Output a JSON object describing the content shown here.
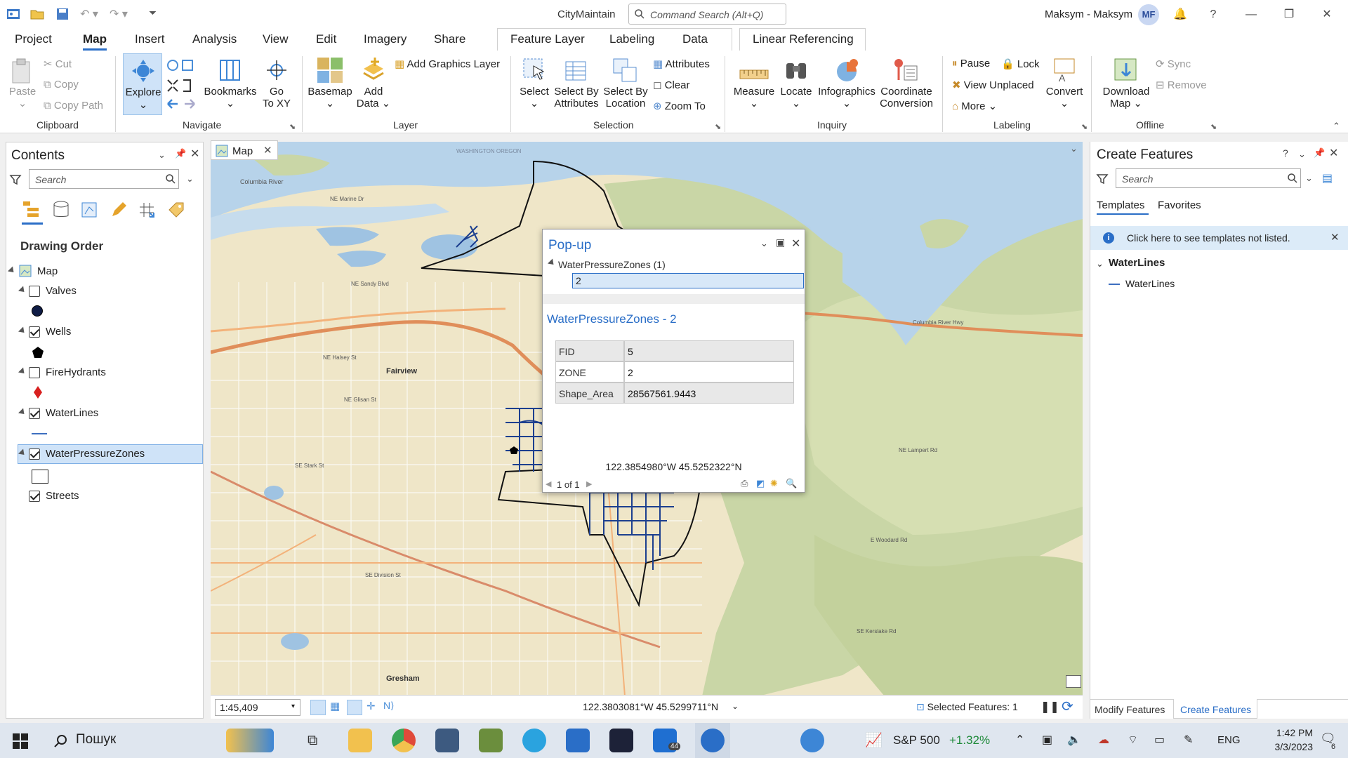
{
  "app": {
    "title": "CityMaintain",
    "command_search_placeholder": "Command Search (Alt+Q)",
    "user": "Maksym - Maksym",
    "user_initials": "MF"
  },
  "tabs": [
    "Project",
    "Map",
    "Insert",
    "Analysis",
    "View",
    "Edit",
    "Imagery",
    "Share"
  ],
  "active_tab": "Map",
  "context_tabs": {
    "feature_layer": "Feature Layer",
    "labeling": "Labeling",
    "data": "Data",
    "linear_referencing": "Linear Referencing"
  },
  "ribbon": {
    "clipboard": {
      "paste": "Paste",
      "cut": "Cut",
      "copy": "Copy",
      "copy_path": "Copy Path",
      "group": "Clipboard"
    },
    "navigate": {
      "explore": "Explore",
      "bookmarks": "Bookmarks",
      "go_to_xy_1": "Go",
      "go_to_xy_2": "To XY",
      "group": "Navigate"
    },
    "layer": {
      "basemap": "Basemap",
      "add_data_1": "Add",
      "add_data_2": "Data",
      "add_graphics_layer": "Add Graphics Layer",
      "group": "Layer"
    },
    "selection": {
      "select": "Select",
      "select_by_attributes_1": "Select By",
      "select_by_attributes_2": "Attributes",
      "select_by_location_1": "Select By",
      "select_by_location_2": "Location",
      "attributes": "Attributes",
      "clear": "Clear",
      "zoom_to": "Zoom To",
      "group": "Selection"
    },
    "inquiry": {
      "measure": "Measure",
      "locate": "Locate",
      "infographics": "Infographics",
      "coordinate_conversion_1": "Coordinate",
      "coordinate_conversion_2": "Conversion",
      "group": "Inquiry"
    },
    "labeling": {
      "pause": "Pause",
      "lock": "Lock",
      "view_unplaced": "View Unplaced",
      "more": "More",
      "convert": "Convert",
      "group": "Labeling"
    },
    "offline": {
      "download_map_1": "Download",
      "download_map_2": "Map",
      "sync": "Sync",
      "remove": "Remove",
      "group": "Offline"
    }
  },
  "contents": {
    "title": "Contents",
    "search_placeholder": "Search",
    "drawing_order": "Drawing Order",
    "map_label": "Map",
    "layers": [
      {
        "name": "Valves",
        "checked": false
      },
      {
        "name": "Wells",
        "checked": true
      },
      {
        "name": "FireHydrants",
        "checked": false
      },
      {
        "name": "WaterLines",
        "checked": true
      },
      {
        "name": "WaterPressureZones",
        "checked": true
      },
      {
        "name": "Streets",
        "checked": true
      }
    ]
  },
  "map_tab": "Map",
  "popup": {
    "title": "Pop-up",
    "layer_node": "WaterPressureZones (1)",
    "feature_node": "2",
    "feature_title": "WaterPressureZones - 2",
    "attributes": [
      {
        "key": "FID",
        "value": "5"
      },
      {
        "key": "ZONE",
        "value": "2"
      },
      {
        "key": "Shape_Area",
        "value": "28567561.9443"
      }
    ],
    "coordinates": "122.3854980°W 45.5252322°N",
    "pager": "1 of 1"
  },
  "status": {
    "scale": "1:45,409",
    "coordinates": "122.3803081°W 45.5299711°N",
    "selected_features": "Selected Features: 1"
  },
  "create_features": {
    "title": "Create Features",
    "search_placeholder": "Search",
    "tab_templates": "Templates",
    "tab_favorites": "Favorites",
    "info": "Click here to see templates not listed.",
    "group": "WaterLines",
    "template": "WaterLines",
    "bottom_tab_modify": "Modify Features",
    "bottom_tab_create": "Create Features"
  },
  "map_labels": {
    "fairview": "Fairview",
    "gresham": "Gresham",
    "columbia_river": "Columbia River",
    "washington_oregon": "WASHINGTON OREGON",
    "sandy_blvd": "NE Sandy Blvd",
    "marine_dr": "NE Marine Dr",
    "halsey": "NE Halsey St",
    "glisan": "NE Glisan St",
    "stark": "SE Stark St",
    "division": "SE Division St",
    "columbia_river_hwy": "Columbia River Hwy",
    "woodard": "E Woodard Rd",
    "kerslake": "SE Kerslake Rd",
    "lampert": "NE Lampert Rd"
  },
  "taskbar": {
    "search": "Пошук",
    "ticker": "S&P 500",
    "ticker_change": "+1.32%",
    "lang": "ENG",
    "time": "1:42 PM",
    "date": "3/3/2023",
    "badge_mail": "44",
    "notif": "6"
  },
  "colors": {
    "accent": "#2a6ec7",
    "waterlines": "#1c3f8f",
    "map_bg": "#efe6c8",
    "water": "#b7d3ea",
    "hills": "#c9d6a6"
  }
}
